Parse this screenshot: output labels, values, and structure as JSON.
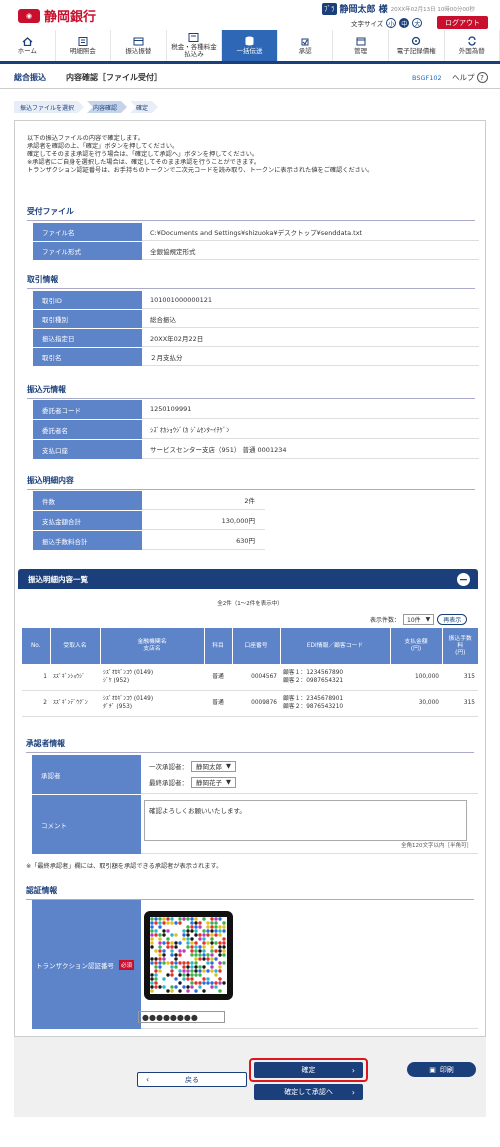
{
  "header": {
    "bank_name": "静岡銀行",
    "logo_mark": "しずぎん",
    "user_badge": "ﾌﾞﾗ",
    "user_name": "静岡太郎 様",
    "datetime": "20XX年02月13日 10時00分00秒",
    "font_size_label": "文字サイズ",
    "font_sizes": [
      "小",
      "中",
      "大"
    ],
    "logout": "ログアウト"
  },
  "nav": [
    {
      "label": "ホーム",
      "icon": "home-icon"
    },
    {
      "label": "明細照会",
      "icon": "list-icon"
    },
    {
      "label": "振込振替",
      "icon": "transfer-icon"
    },
    {
      "label": "税金・各種料金\n払込み",
      "icon": "tax-icon"
    },
    {
      "label": "一括伝送",
      "icon": "database-icon"
    },
    {
      "label": "承認",
      "icon": "approve-icon"
    },
    {
      "label": "管理",
      "icon": "manage-icon"
    },
    {
      "label": "電子記録債権",
      "icon": "edocument-icon"
    },
    {
      "label": "外国為替",
      "icon": "forex-icon"
    }
  ],
  "title": {
    "section": "総合振込",
    "main": "内容確認［ファイル受付］",
    "screen_code": "BSGF102",
    "help": "ヘルプ"
  },
  "steps": [
    "振込ファイルを選択",
    "内容確認",
    "確定"
  ],
  "intro": "以下の振込ファイルの内容で確定します。\n承認者を確認の上、「確定」ボタンを押してください。\n確定してそのまま承認を行う場合は、「確定して承認へ」ボタンを押してください。\n※承認者にご自身を選択した場合は、確定してそのまま承認を行うことができます。\nトランザクション認証番号は、お手持ちのトークンで二次元コードを読み取り、トークンに表示された値をご確認ください。",
  "file_section": {
    "title": "受付ファイル",
    "rows": [
      {
        "label": "ファイル名",
        "value": "C:¥Documents and Settings¥shizuoka¥デスクトップ¥senddata.txt"
      },
      {
        "label": "ファイル形式",
        "value": "全銀協規定形式"
      }
    ]
  },
  "transaction_section": {
    "title": "取引情報",
    "rows": [
      {
        "label": "取引ID",
        "value": "101001000000121"
      },
      {
        "label": "取引種別",
        "value": "総合振込"
      },
      {
        "label": "振込指定日",
        "value": "20XX年02月22日"
      },
      {
        "label": "取引名",
        "value": "２月支払分"
      }
    ]
  },
  "source_section": {
    "title": "振込元情報",
    "rows": [
      {
        "label": "委託者コード",
        "value": "1250109991"
      },
      {
        "label": "委託者名",
        "value": "ｼｽﾞｵｶｼｮｳｼﾞ(ｶ ｼﾞﾑｾﾝﾀｰｲﾁｹﾞﾝ"
      },
      {
        "label": "支払口座",
        "value": "サービスセンター支店（951） 普通 0001234"
      }
    ]
  },
  "summary_section": {
    "title": "振込明細内容",
    "rows": [
      {
        "label": "件数",
        "value": "2件"
      },
      {
        "label": "支払金額合計",
        "value": "130,000円"
      },
      {
        "label": "振込手数料合計",
        "value": "630円"
      }
    ]
  },
  "detail_list": {
    "title": "振込明細内容一覧",
    "count_text": "全2件（1〜2件を表示中）",
    "show_count_label": "表示件数：",
    "show_count_value": "10件",
    "redisplay": "再表示",
    "headers": [
      "No.",
      "受取人名",
      "金融機関名\n支店名",
      "科目",
      "口座番号",
      "EDI情報／顧客コード",
      "支払金額\n(円)",
      "振込手数\n料\n(円)"
    ],
    "rows": [
      {
        "no": "1",
        "name": "ｽｽﾞｷﾞﾝｼｮｳｼﾞ",
        "bank": "ｼｽﾞｵｶｷﾞﾝｺｳ (0149)",
        "branch": "ｼﾞｹ (952)",
        "type": "普通",
        "account": "0004567",
        "code1": "顧客１：1234567890",
        "code2": "顧客２：0987654321",
        "amount": "100,000",
        "fee": "315"
      },
      {
        "no": "2",
        "name": "ｽｽﾞｷﾞﾝﾃﾞｳｸﾞﾝ",
        "bank": "ｼｽﾞｵｶｷﾞﾝｺｳ (0149)",
        "branch": "ﾀﾞﾁﾞ (953)",
        "type": "普通",
        "account": "0009876",
        "code1": "顧客１：2345678901",
        "code2": "顧客２：9876543210",
        "amount": "30,000",
        "fee": "315"
      }
    ]
  },
  "approver_section": {
    "title": "承認者情報",
    "approver_label": "承認者",
    "first_label": "一次承認者：",
    "first_value": "静岡太郎",
    "final_label": "最終承認者：",
    "final_value": "静岡花子",
    "comment_label": "コメント",
    "comment_value": "確認よろしくお願いいたします。",
    "comment_limit": "全角120文字以内［半角可］",
    "note": "※「最終承認者」欄には、取引額を承認できる承認者が表示されます。"
  },
  "auth_section": {
    "title": "認証情報",
    "label": "トランザクション認証番号",
    "required": "必須",
    "password_mask": "●●●●●●●●"
  },
  "buttons": {
    "back": "戻る",
    "confirm": "確定",
    "confirm_approve": "確定して承認へ",
    "print": "印刷"
  },
  "colors": {
    "brand_red": "#c8102e",
    "navy": "#1b3f7a",
    "label_blue": "#5d83c8",
    "highlight": "#e0161d"
  }
}
